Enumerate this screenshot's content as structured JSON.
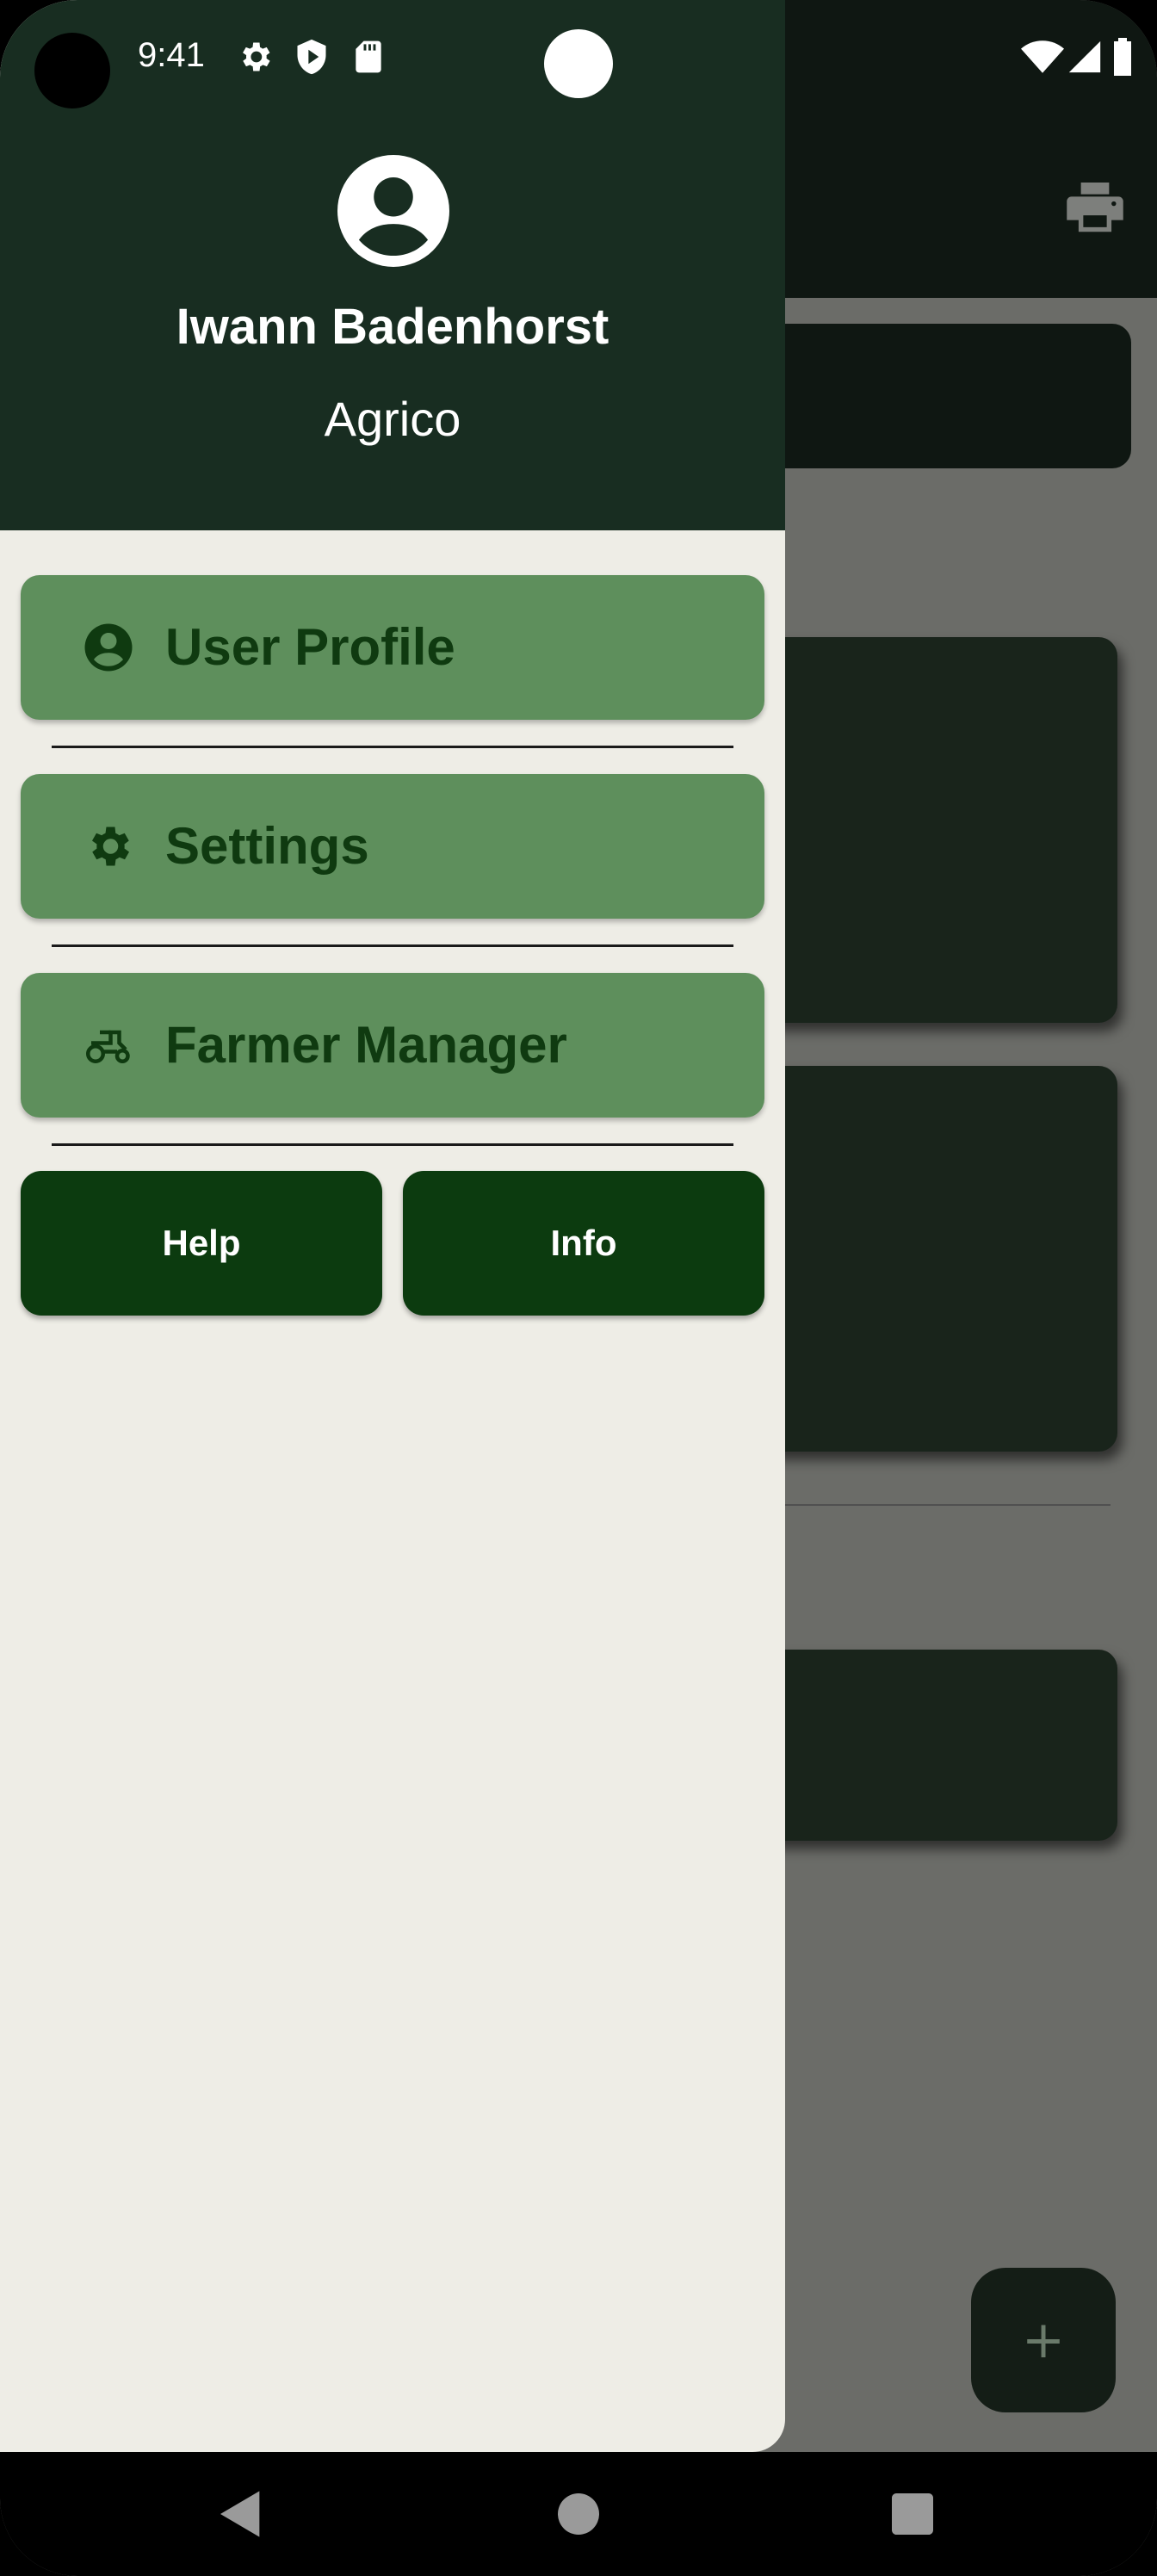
{
  "status_bar": {
    "time": "9:41",
    "left_icons": [
      "gear-icon",
      "shield-play-icon",
      "sd-card-icon"
    ],
    "right_icons": [
      "wifi-icon",
      "signal-icon",
      "battery-icon"
    ]
  },
  "drawer": {
    "header": {
      "avatar_icon": "account-circle-icon",
      "user_name": "Iwann Badenhorst",
      "organization": "Agrico"
    },
    "menu_items": [
      {
        "label": "User Profile",
        "icon": "account-circle-icon"
      },
      {
        "label": "Settings",
        "icon": "gear-icon"
      },
      {
        "label": "Farmer Manager",
        "icon": "tractor-icon"
      }
    ],
    "buttons": [
      {
        "label": "Help"
      },
      {
        "label": "Info"
      }
    ]
  },
  "background_app": {
    "print_icon": "print-icon",
    "fab_icon": "plus-icon",
    "fab_label": "+"
  },
  "nav_bar": {
    "buttons": [
      "back-icon",
      "home-icon",
      "recents-icon"
    ]
  },
  "colors": {
    "header_bg": "#182d21",
    "drawer_bg": "#eeede6",
    "menu_item_bg": "#5e8f5c",
    "menu_text": "#0f3a10",
    "button_bg": "#0c3b0f",
    "scrim": "#6b6c68"
  }
}
